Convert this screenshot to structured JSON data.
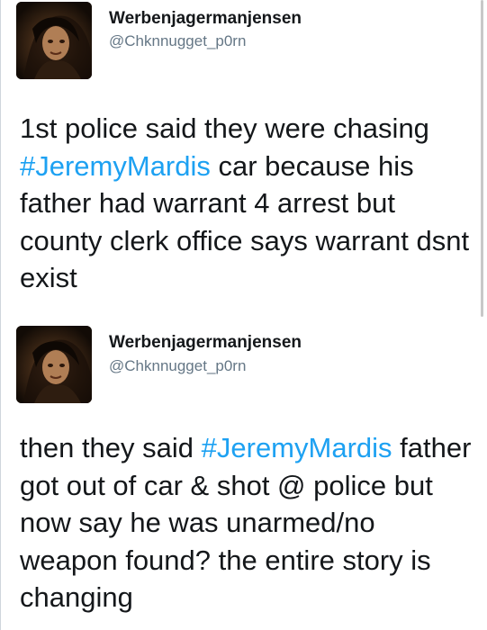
{
  "tweets": [
    {
      "display_name": "Werbenjagermanjensen",
      "handle": "@Chknnugget_p0rn",
      "avatar_icon": "profile-photo",
      "text_before": "1st police said they were chasing ",
      "hashtag": "#JeremyMardis",
      "text_after": " car because his father had warrant 4 arrest but county clerk office says warrant dsnt exist"
    },
    {
      "display_name": "Werbenjagermanjensen",
      "handle": "@Chknnugget_p0rn",
      "avatar_icon": "profile-photo",
      "text_before": "then they said ",
      "hashtag": "#JeremyMardis",
      "text_after": " father got out of car & shot @ police but now say he was unarmed/no weapon found? the entire story is changing"
    }
  ],
  "colors": {
    "hashtag": "#1da1f2",
    "handle": "#657786",
    "text": "#14171a"
  }
}
